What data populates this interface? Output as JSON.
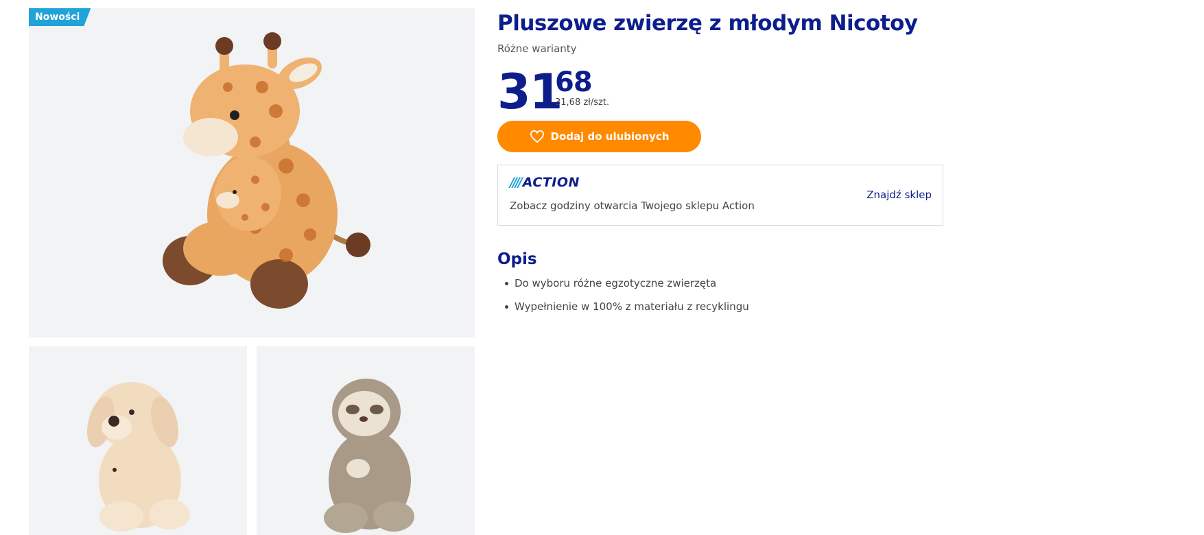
{
  "badge": {
    "label": "Nowości"
  },
  "product": {
    "title": "Pluszowe zwierzę z młodym Nicotoy",
    "subtitle": "Różne warianty",
    "price_int": "31",
    "price_dec": "68",
    "price_unit": "31,68 zł/szt."
  },
  "actions": {
    "favorite_label": "Dodaj do ulubionych",
    "favorite_icon": "heart-icon"
  },
  "store": {
    "logo_slashes": "////",
    "logo_brand": "ACTION",
    "hours_text": "Zobacz godziny otwarcia Twojego sklepu Action",
    "find_link": "Znajdź sklep"
  },
  "description": {
    "heading": "Opis",
    "items": [
      "Do wyboru różne egzotyczne zwierzęta",
      "Wypełnienie w 100% z materiału z recyklingu"
    ]
  },
  "colors": {
    "brand_blue": "#0d1e8c",
    "accent_orange": "#ff8a00",
    "badge_cyan": "#1fa3d8",
    "image_bg": "#f1f3f5"
  }
}
